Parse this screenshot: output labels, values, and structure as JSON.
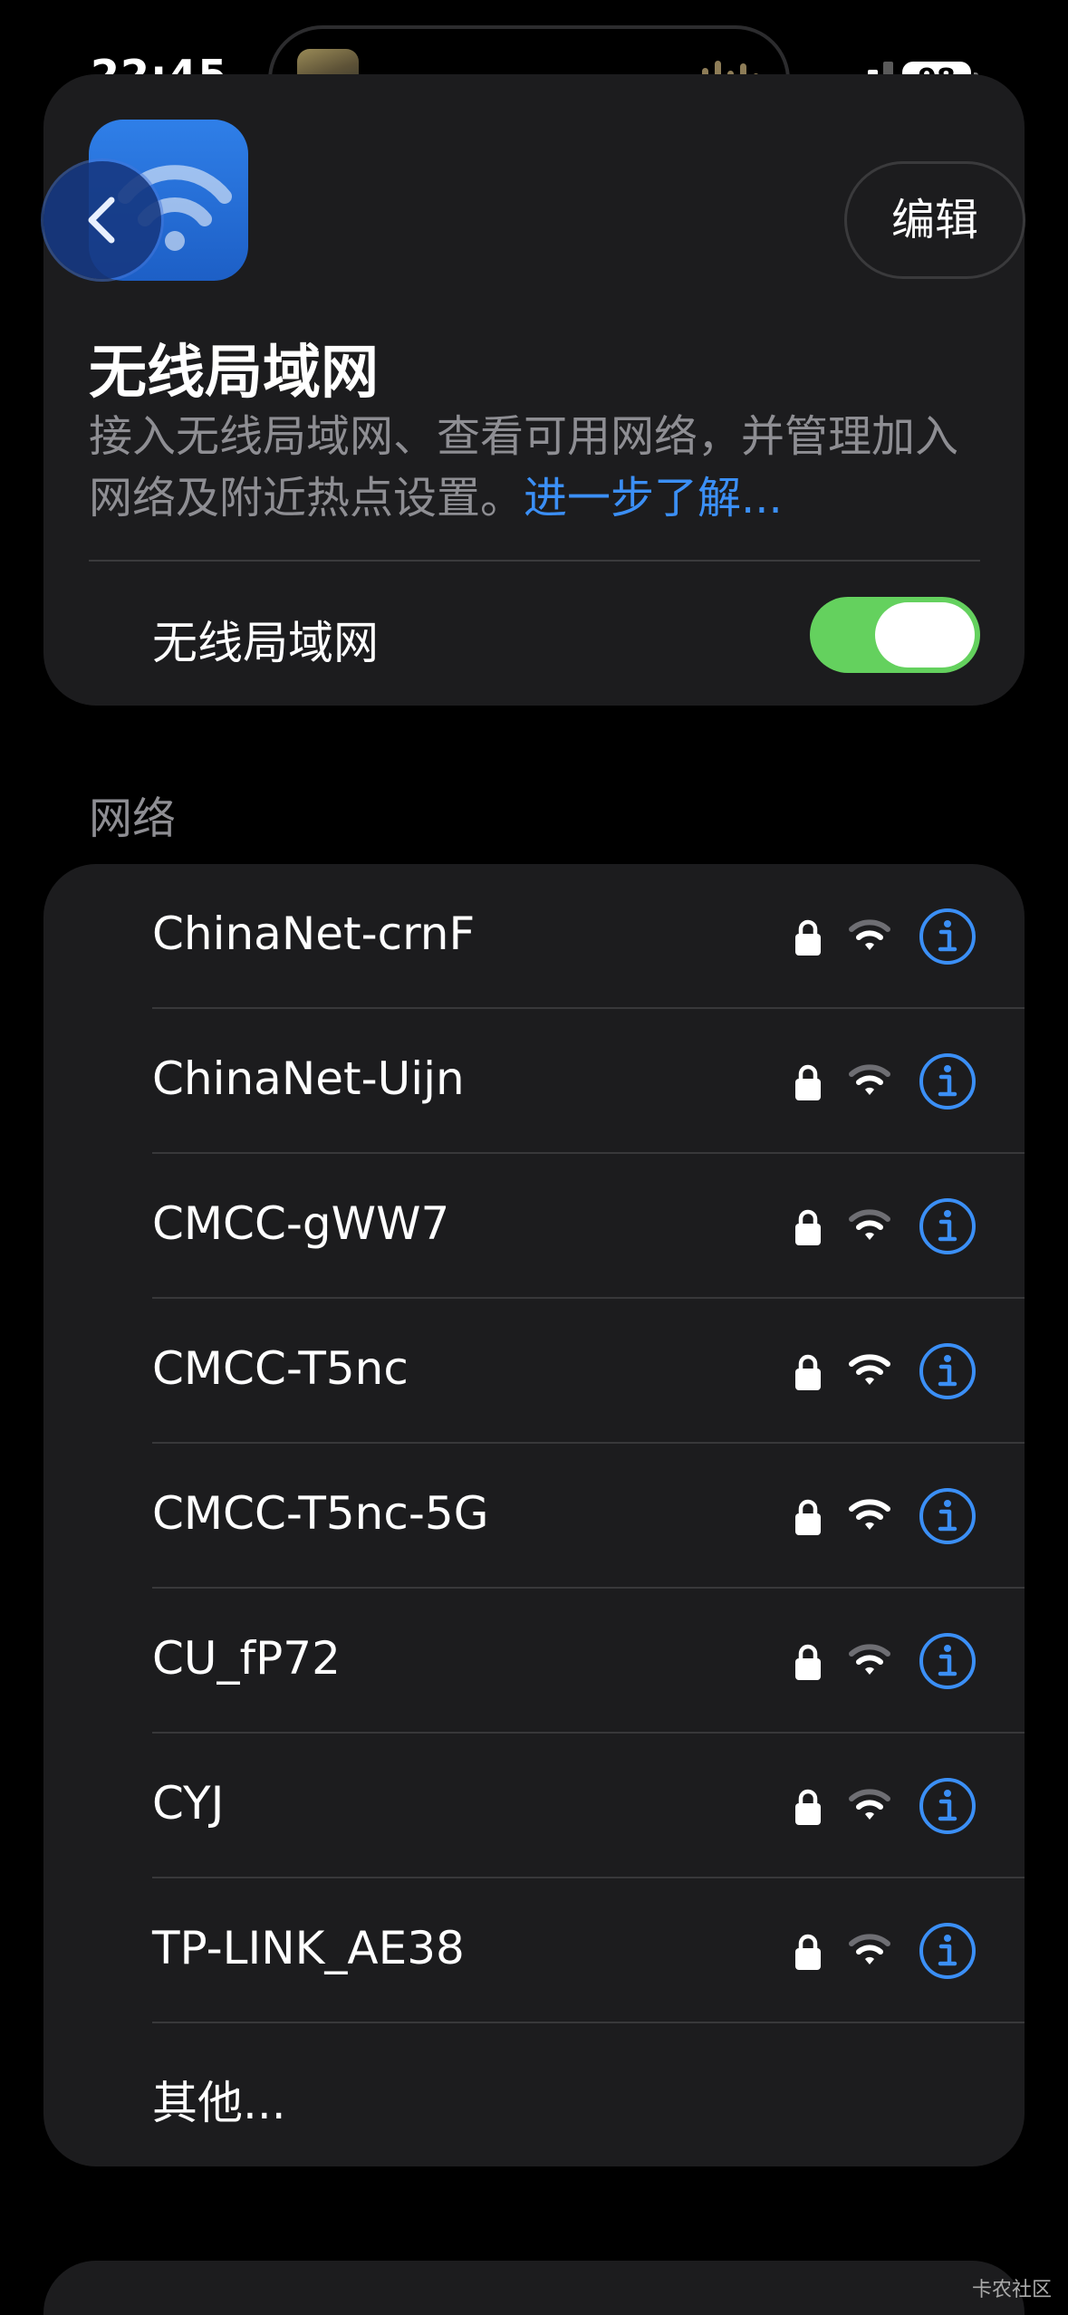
{
  "status_bar": {
    "time": "22:45",
    "battery": "98"
  },
  "header": {
    "edit_label": "编辑",
    "title": "无线局域网",
    "description": "接入无线局域网、查看可用网络，并管理加入网络及附近热点设置。",
    "learn_more": "进一步了解..."
  },
  "wifi_toggle": {
    "label": "无线局域网",
    "on": true,
    "accent": "#64d15e"
  },
  "networks_section": {
    "label": "网络",
    "items": [
      {
        "name": "ChinaNet-crnF",
        "locked": true,
        "signal": "medium"
      },
      {
        "name": "ChinaNet-Uijn",
        "locked": true,
        "signal": "medium"
      },
      {
        "name": "CMCC-gWW7",
        "locked": true,
        "signal": "medium"
      },
      {
        "name": "CMCC-T5nc",
        "locked": true,
        "signal": "full"
      },
      {
        "name": "CMCC-T5nc-5G",
        "locked": true,
        "signal": "full"
      },
      {
        "name": "CU_fP72",
        "locked": true,
        "signal": "medium"
      },
      {
        "name": "CYJ",
        "locked": true,
        "signal": "medium"
      },
      {
        "name": "TP-LINK_AE38",
        "locked": true,
        "signal": "medium"
      }
    ],
    "other_label": "其他..."
  },
  "colors": {
    "link": "#3b8ff6",
    "card": "#1c1c1e"
  },
  "watermark": "卡农社区"
}
